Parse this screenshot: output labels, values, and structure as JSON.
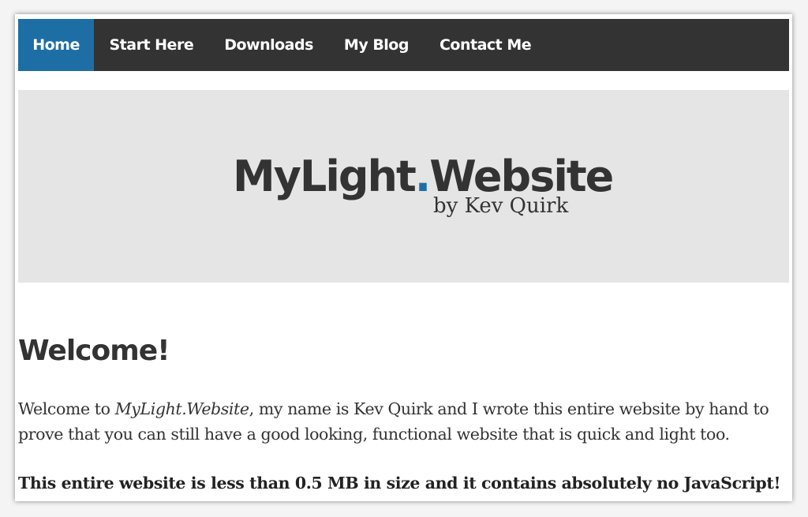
{
  "nav": {
    "items": [
      {
        "label": "Home",
        "active": true
      },
      {
        "label": "Start Here",
        "active": false
      },
      {
        "label": "Downloads",
        "active": false
      },
      {
        "label": "My Blog",
        "active": false
      },
      {
        "label": "Contact Me",
        "active": false
      }
    ]
  },
  "hero": {
    "logo_part1": "MyLight",
    "logo_dot": ".",
    "logo_part2": "Website",
    "logo_byline": "by Kev Quirk"
  },
  "content": {
    "heading": "Welcome!",
    "intro_prefix": "Welcome to ",
    "intro_site": "MyLight.Website",
    "intro_rest": ", my name is Kev Quirk and I wrote this entire website by hand to prove that you can still have a good looking, functional website that is quick and light too.",
    "claim": "This entire website is less than 0.5 MB in size and it contains absolutely no JavaScript!"
  },
  "colors": {
    "accent": "#1e6ea6",
    "nav_background": "#333333",
    "hero_background": "#e5e5e5",
    "text": "#333333"
  }
}
